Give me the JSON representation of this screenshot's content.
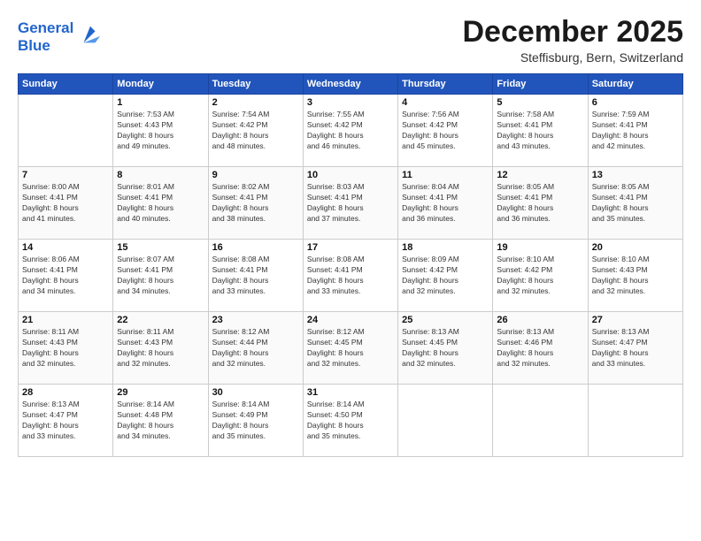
{
  "logo": {
    "line1": "General",
    "line2": "Blue"
  },
  "title": "December 2025",
  "subtitle": "Steffisburg, Bern, Switzerland",
  "headers": [
    "Sunday",
    "Monday",
    "Tuesday",
    "Wednesday",
    "Thursday",
    "Friday",
    "Saturday"
  ],
  "weeks": [
    [
      {
        "day": "",
        "info": ""
      },
      {
        "day": "1",
        "info": "Sunrise: 7:53 AM\nSunset: 4:43 PM\nDaylight: 8 hours\nand 49 minutes."
      },
      {
        "day": "2",
        "info": "Sunrise: 7:54 AM\nSunset: 4:42 PM\nDaylight: 8 hours\nand 48 minutes."
      },
      {
        "day": "3",
        "info": "Sunrise: 7:55 AM\nSunset: 4:42 PM\nDaylight: 8 hours\nand 46 minutes."
      },
      {
        "day": "4",
        "info": "Sunrise: 7:56 AM\nSunset: 4:42 PM\nDaylight: 8 hours\nand 45 minutes."
      },
      {
        "day": "5",
        "info": "Sunrise: 7:58 AM\nSunset: 4:41 PM\nDaylight: 8 hours\nand 43 minutes."
      },
      {
        "day": "6",
        "info": "Sunrise: 7:59 AM\nSunset: 4:41 PM\nDaylight: 8 hours\nand 42 minutes."
      }
    ],
    [
      {
        "day": "7",
        "info": "Sunrise: 8:00 AM\nSunset: 4:41 PM\nDaylight: 8 hours\nand 41 minutes."
      },
      {
        "day": "8",
        "info": "Sunrise: 8:01 AM\nSunset: 4:41 PM\nDaylight: 8 hours\nand 40 minutes."
      },
      {
        "day": "9",
        "info": "Sunrise: 8:02 AM\nSunset: 4:41 PM\nDaylight: 8 hours\nand 38 minutes."
      },
      {
        "day": "10",
        "info": "Sunrise: 8:03 AM\nSunset: 4:41 PM\nDaylight: 8 hours\nand 37 minutes."
      },
      {
        "day": "11",
        "info": "Sunrise: 8:04 AM\nSunset: 4:41 PM\nDaylight: 8 hours\nand 36 minutes."
      },
      {
        "day": "12",
        "info": "Sunrise: 8:05 AM\nSunset: 4:41 PM\nDaylight: 8 hours\nand 36 minutes."
      },
      {
        "day": "13",
        "info": "Sunrise: 8:05 AM\nSunset: 4:41 PM\nDaylight: 8 hours\nand 35 minutes."
      }
    ],
    [
      {
        "day": "14",
        "info": "Sunrise: 8:06 AM\nSunset: 4:41 PM\nDaylight: 8 hours\nand 34 minutes."
      },
      {
        "day": "15",
        "info": "Sunrise: 8:07 AM\nSunset: 4:41 PM\nDaylight: 8 hours\nand 34 minutes."
      },
      {
        "day": "16",
        "info": "Sunrise: 8:08 AM\nSunset: 4:41 PM\nDaylight: 8 hours\nand 33 minutes."
      },
      {
        "day": "17",
        "info": "Sunrise: 8:08 AM\nSunset: 4:41 PM\nDaylight: 8 hours\nand 33 minutes."
      },
      {
        "day": "18",
        "info": "Sunrise: 8:09 AM\nSunset: 4:42 PM\nDaylight: 8 hours\nand 32 minutes."
      },
      {
        "day": "19",
        "info": "Sunrise: 8:10 AM\nSunset: 4:42 PM\nDaylight: 8 hours\nand 32 minutes."
      },
      {
        "day": "20",
        "info": "Sunrise: 8:10 AM\nSunset: 4:43 PM\nDaylight: 8 hours\nand 32 minutes."
      }
    ],
    [
      {
        "day": "21",
        "info": "Sunrise: 8:11 AM\nSunset: 4:43 PM\nDaylight: 8 hours\nand 32 minutes."
      },
      {
        "day": "22",
        "info": "Sunrise: 8:11 AM\nSunset: 4:43 PM\nDaylight: 8 hours\nand 32 minutes."
      },
      {
        "day": "23",
        "info": "Sunrise: 8:12 AM\nSunset: 4:44 PM\nDaylight: 8 hours\nand 32 minutes."
      },
      {
        "day": "24",
        "info": "Sunrise: 8:12 AM\nSunset: 4:45 PM\nDaylight: 8 hours\nand 32 minutes."
      },
      {
        "day": "25",
        "info": "Sunrise: 8:13 AM\nSunset: 4:45 PM\nDaylight: 8 hours\nand 32 minutes."
      },
      {
        "day": "26",
        "info": "Sunrise: 8:13 AM\nSunset: 4:46 PM\nDaylight: 8 hours\nand 32 minutes."
      },
      {
        "day": "27",
        "info": "Sunrise: 8:13 AM\nSunset: 4:47 PM\nDaylight: 8 hours\nand 33 minutes."
      }
    ],
    [
      {
        "day": "28",
        "info": "Sunrise: 8:13 AM\nSunset: 4:47 PM\nDaylight: 8 hours\nand 33 minutes."
      },
      {
        "day": "29",
        "info": "Sunrise: 8:14 AM\nSunset: 4:48 PM\nDaylight: 8 hours\nand 34 minutes."
      },
      {
        "day": "30",
        "info": "Sunrise: 8:14 AM\nSunset: 4:49 PM\nDaylight: 8 hours\nand 35 minutes."
      },
      {
        "day": "31",
        "info": "Sunrise: 8:14 AM\nSunset: 4:50 PM\nDaylight: 8 hours\nand 35 minutes."
      },
      {
        "day": "",
        "info": ""
      },
      {
        "day": "",
        "info": ""
      },
      {
        "day": "",
        "info": ""
      }
    ]
  ]
}
